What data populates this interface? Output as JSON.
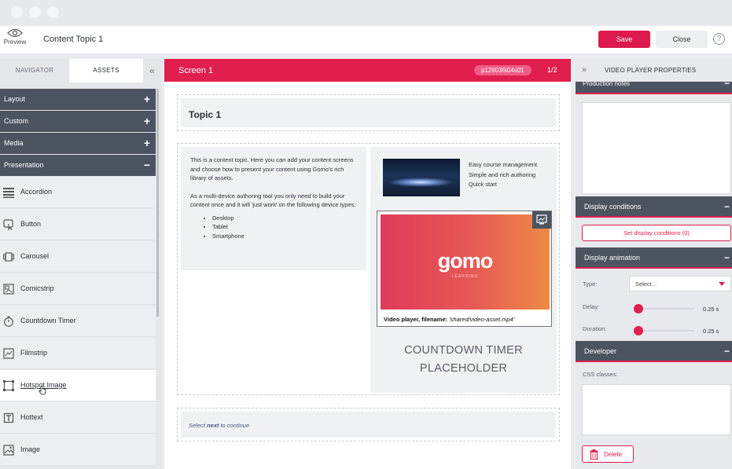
{
  "window": {
    "title": "Content Topic 1"
  },
  "toolbar": {
    "preview_label": "Preview",
    "save_label": "Save",
    "close_label": "Close",
    "help_label": "?"
  },
  "left_panel": {
    "tabs": [
      {
        "label": "NAVIGATOR"
      },
      {
        "label": "ASSETS"
      }
    ],
    "collapse_label": "«",
    "categories": [
      {
        "label": "Layout",
        "sign": "+"
      },
      {
        "label": "Custom",
        "sign": "+"
      },
      {
        "label": "Media",
        "sign": "+"
      },
      {
        "label": "Presentation",
        "sign": "−"
      }
    ],
    "assets": [
      {
        "label": "Accordion",
        "icon": "accordion-icon"
      },
      {
        "label": "Button",
        "icon": "button-icon"
      },
      {
        "label": "Carousel",
        "icon": "carousel-icon"
      },
      {
        "label": "Comicstrip",
        "icon": "comicstrip-icon"
      },
      {
        "label": "Countdown Timer",
        "icon": "stopwatch-icon"
      },
      {
        "label": "Filmstrip",
        "icon": "filmstrip-icon"
      },
      {
        "label": "Hotspot Image",
        "icon": "hotspot-image-icon"
      },
      {
        "label": "Hottext",
        "icon": "hottext-icon"
      },
      {
        "label": "Image",
        "icon": "image-icon"
      }
    ]
  },
  "canvas": {
    "screen_title": "Screen 1",
    "screen_id": "p126036i04s01",
    "pages": "1/2",
    "topic_heading": "Topic 1",
    "intro_text": "This is a content topic. Here you can add your content screens and choose how to present your content using Gomo's rich library of assets.",
    "device_text": "As a multi-device authoring tool you only need to build your content once and it will 'just work' on the following device types:",
    "devices": [
      "Desktop",
      "Tablet",
      "Smartphone"
    ],
    "links": [
      "Easy course management",
      "Simple and rich authoring",
      "Quick start"
    ],
    "video_logo": "gomo",
    "video_logo_sub": "LEARNING",
    "video_caption_label": "Video player, filename:",
    "video_caption_file": "'shared/video-asset.mp4'",
    "countdown_line1": "COUNTDOWN TIMER",
    "countdown_line2": "PLACEHOLDER",
    "next_pre": "Select ",
    "next_bold": "next",
    "next_post": " to continue"
  },
  "right_panel": {
    "expand_label": "»",
    "title": "VIDEO PLAYER PROPERTIES",
    "production_notes": "Production notes",
    "display_conditions": "Display conditions",
    "set_conditions_button": "Set display conditions (0)",
    "display_animation": "Display animation",
    "type_label": "Type:",
    "type_value": "Select...",
    "delay_label": "Delay:",
    "delay_value": "0.25 s",
    "duration_label": "Duration:",
    "duration_value": "0.25 s",
    "developer": "Developer",
    "css_label": "CSS classes:",
    "delete_label": "Delete",
    "section_sign": "−"
  },
  "colors": {
    "accent": "#e01f4f",
    "dark_panel": "#4c5361",
    "light_bg": "#eff1f3"
  }
}
